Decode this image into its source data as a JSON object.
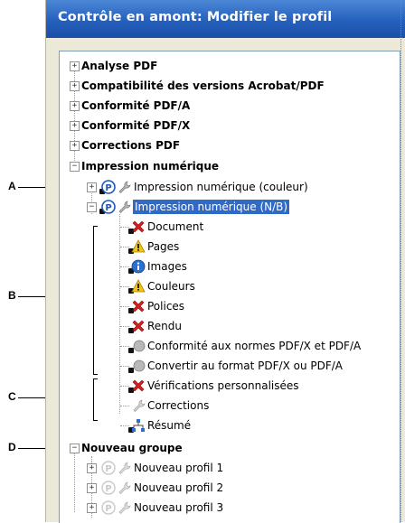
{
  "window": {
    "title": "Contrôle en amont: Modifier le profil"
  },
  "callouts": {
    "a": "A",
    "b": "B",
    "c": "C",
    "d": "D"
  },
  "tree": {
    "top_groups": [
      "Analyse PDF",
      "Compatibilité des versions Acrobat/PDF",
      "Conformité PDF/A",
      "Conformité PDF/X",
      "Corrections PDF",
      "Impression numérique"
    ],
    "profiles": {
      "couleur": "Impression numérique (couleur)",
      "nb": "Impression numérique (N/B)"
    },
    "checks": [
      {
        "label": "Document",
        "icon": "error-x-icon"
      },
      {
        "label": "Pages",
        "icon": "warning-icon"
      },
      {
        "label": "Images",
        "icon": "info-icon"
      },
      {
        "label": "Couleurs",
        "icon": "warning-icon"
      },
      {
        "label": "Polices",
        "icon": "error-x-icon"
      },
      {
        "label": "Rendu",
        "icon": "error-x-icon"
      },
      {
        "label": "Conformité aux normes PDF/X et PDF/A",
        "icon": "disabled-circle-icon"
      },
      {
        "label": "Convertir au format PDF/X ou PDF/A",
        "icon": "disabled-circle-icon"
      },
      {
        "label": "Vérifications personnalisées",
        "icon": "error-x-icon"
      },
      {
        "label": "Corrections",
        "icon": "wrench-icon"
      },
      {
        "label": "Résumé",
        "icon": "hierarchy-icon"
      }
    ],
    "new_group": {
      "label": "Nouveau groupe",
      "profiles": [
        "Nouveau profil 1",
        "Nouveau profil 2",
        "Nouveau profil 3"
      ]
    }
  },
  "colors": {
    "titlebar": "#2460bd",
    "selection": "#316ac5",
    "error": "#d42020",
    "warning": "#f3c518"
  }
}
